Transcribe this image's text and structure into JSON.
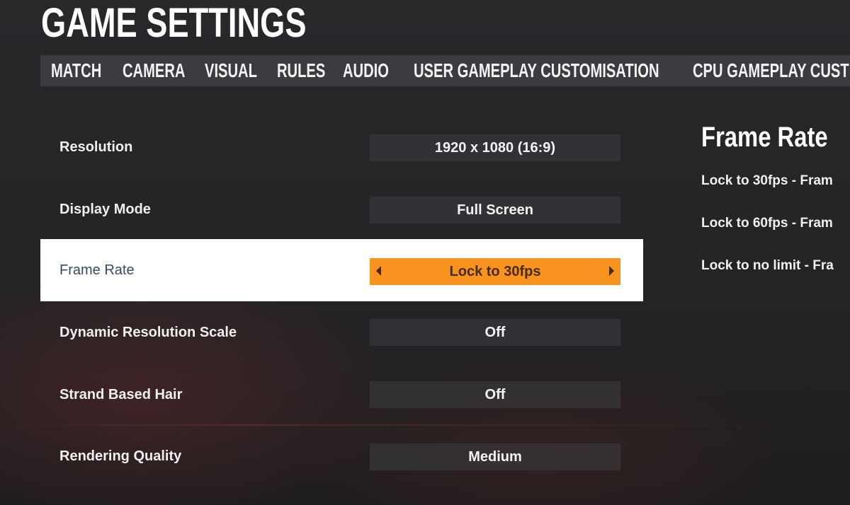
{
  "header": {
    "title": "GAME SETTINGS"
  },
  "tabs": [
    {
      "label": "MATCH"
    },
    {
      "label": "CAMERA"
    },
    {
      "label": "VISUAL"
    },
    {
      "label": "RULES"
    },
    {
      "label": "AUDIO"
    },
    {
      "label": "USER GAMEPLAY CUSTOMISATION"
    },
    {
      "label": "CPU GAMEPLAY CUST"
    }
  ],
  "settings": [
    {
      "label": "Resolution",
      "value": "1920 x 1080 (16:9)"
    },
    {
      "label": "Display Mode",
      "value": "Full Screen"
    },
    {
      "label": "Frame Rate",
      "value": "Lock to 30fps",
      "selected": true
    },
    {
      "label": "Dynamic Resolution Scale",
      "value": "Off"
    },
    {
      "label": "Strand Based Hair",
      "value": "Off"
    },
    {
      "label": "Rendering Quality",
      "value": "Medium"
    }
  ],
  "help_panel": {
    "title": "Frame Rate",
    "lines": [
      "Lock to 30fps - Fram",
      "Lock to 60fps - Fram",
      "Lock to no limit - Fra"
    ]
  },
  "colors": {
    "accent": "#f7931e",
    "selected_row_bg": "#ffffff",
    "tab_bar_bg": "#3a3c3f",
    "background": "#262527"
  }
}
